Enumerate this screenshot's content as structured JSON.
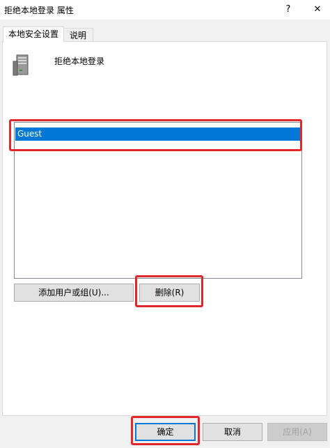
{
  "window": {
    "title": "拒绝本地登录 属性",
    "help_glyph": "?",
    "close_glyph": "✕"
  },
  "tabs": [
    {
      "label": "本地安全设置",
      "active": true
    },
    {
      "label": "说明",
      "active": false
    }
  ],
  "policy": {
    "title": "拒绝本地登录",
    "icon": "server-icon"
  },
  "accounts": {
    "items": [
      {
        "name": "Guest",
        "selected": true
      }
    ]
  },
  "buttons": {
    "add": "添加用户或组(U)...",
    "remove": "删除(R)",
    "ok": "确定",
    "cancel": "取消",
    "apply": "应用(A)"
  },
  "colors": {
    "selection": "#0078d7",
    "highlight_box": "#e0282c"
  }
}
